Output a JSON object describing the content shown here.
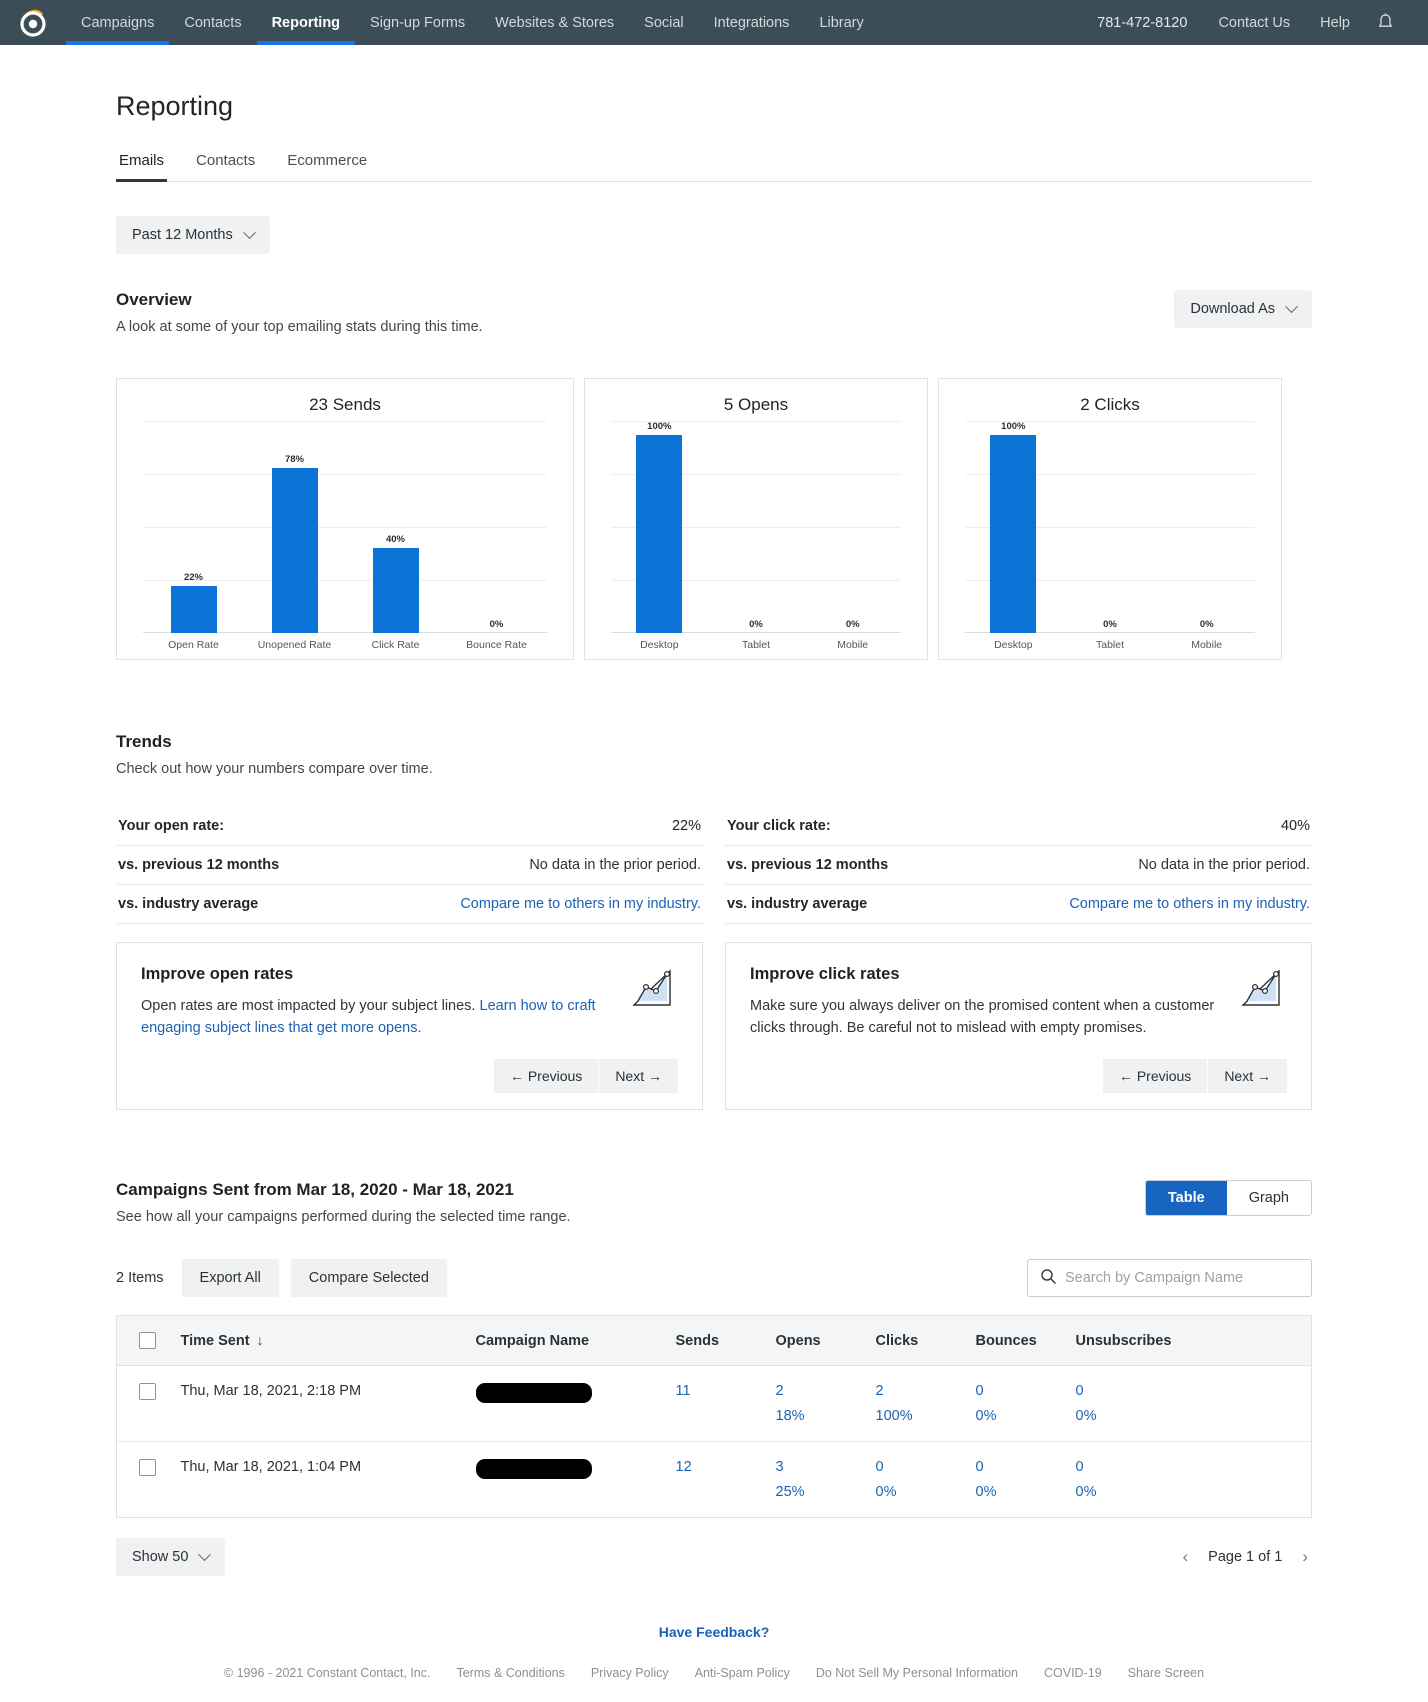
{
  "nav": {
    "logo_icon": "constant-contact-logo-icon",
    "left_items": [
      {
        "label": "Campaigns",
        "active": false
      },
      {
        "label": "Contacts",
        "active": false
      },
      {
        "label": "Reporting",
        "active": true
      },
      {
        "label": "Sign-up Forms",
        "active": false
      },
      {
        "label": "Websites & Stores",
        "active": false
      },
      {
        "label": "Social",
        "active": false
      },
      {
        "label": "Integrations",
        "active": false
      },
      {
        "label": "Library",
        "active": false
      }
    ],
    "phone": "781-472-8120",
    "contact_us": "Contact Us",
    "help": "Help",
    "bell_icon": "notification-bell-icon"
  },
  "page": {
    "title": "Reporting",
    "tabs": [
      {
        "label": "Emails",
        "active": true
      },
      {
        "label": "Contacts",
        "active": false
      },
      {
        "label": "Ecommerce",
        "active": false
      }
    ],
    "date_filter": "Past 12 Months"
  },
  "overview": {
    "title": "Overview",
    "subtitle": "A look at some of your top emailing stats during this time.",
    "download_label": "Download As"
  },
  "trends": {
    "title": "Trends",
    "subtitle": "Check out how your numbers compare over time.",
    "open": {
      "rate_label": "Your open rate:",
      "rate_value": "22%",
      "prev_label": "vs. previous 12 months",
      "prev_value": "No data in the prior period.",
      "industry_label": "vs. industry average",
      "industry_link": "Compare me to others in my industry.",
      "tip_title": "Improve open rates",
      "tip_text_plain": "Open rates are most impacted by your subject lines. ",
      "tip_text_link": "Learn how to craft engaging subject lines that get more opens.",
      "prev_btn": "← Previous",
      "next_btn": "Next →"
    },
    "click": {
      "rate_label": "Your click rate:",
      "rate_value": "40%",
      "prev_label": "vs. previous 12 months",
      "prev_value": "No data in the prior period.",
      "industry_label": "vs. industry average",
      "industry_link": "Compare me to others in my industry.",
      "tip_title": "Improve click rates",
      "tip_text_plain": "Make sure you always deliver on the promised content when a customer clicks through. Be careful not to mislead with empty promises.",
      "tip_text_link": "",
      "prev_btn": "← Previous",
      "next_btn": "Next →"
    }
  },
  "campaigns": {
    "title": "Campaigns Sent from Mar 18, 2020 - Mar 18, 2021",
    "subtitle": "See how all your campaigns performed during the selected time range.",
    "view_toggle": [
      {
        "label": "Table",
        "active": true
      },
      {
        "label": "Graph",
        "active": false
      }
    ],
    "items_count": "2 Items",
    "export_all": "Export All",
    "compare_selected": "Compare Selected",
    "search_placeholder": "Search by Campaign Name",
    "search_value": "",
    "search_icon": "search-icon",
    "columns": [
      "Time Sent",
      "Campaign Name",
      "Sends",
      "Opens",
      "Clicks",
      "Bounces",
      "Unsubscribes"
    ],
    "sort_column": "Time Sent",
    "sort_direction_icon": "arrow-down-icon",
    "rows": [
      {
        "time_sent": "Thu, Mar 18, 2021, 2:18 PM",
        "campaign_name": "",
        "sends": "11",
        "opens": "2",
        "opens_pct": "18%",
        "clicks": "2",
        "clicks_pct": "100%",
        "bounces": "0",
        "bounces_pct": "0%",
        "unsubscribes": "0",
        "unsubscribes_pct": "0%"
      },
      {
        "time_sent": "Thu, Mar 18, 2021, 1:04 PM",
        "campaign_name": "",
        "sends": "12",
        "opens": "3",
        "opens_pct": "25%",
        "clicks": "0",
        "clicks_pct": "0%",
        "bounces": "0",
        "bounces_pct": "0%",
        "unsubscribes": "0",
        "unsubscribes_pct": "0%"
      }
    ],
    "show_per_page": "Show 50",
    "page_label": "Page 1 of 1",
    "prev_page_icon": "chevron-left-icon",
    "next_page_icon": "chevron-right-icon"
  },
  "footer": {
    "feedback": "Have Feedback?",
    "copyright": "© 1996 - 2021 Constant Contact, Inc.",
    "links": [
      "Terms & Conditions",
      "Privacy Policy",
      "Anti-Spam Policy",
      "Do Not Sell My Personal Information",
      "COVID-19",
      "Share Screen"
    ]
  },
  "colors": {
    "nav_bg": "#3b4d56",
    "bar_blue": "#0b72d6",
    "link_blue": "#1b62b5",
    "accent_blue": "#1765c0"
  },
  "chart_data": [
    {
      "type": "bar",
      "title": "23 Sends",
      "categories": [
        "Open Rate",
        "Unopened Rate",
        "Click Rate",
        "Bounce Rate"
      ],
      "values": [
        22,
        78,
        40,
        0
      ],
      "value_labels": [
        "22%",
        "78%",
        "40%",
        "0%"
      ],
      "ylim": [
        0,
        100
      ],
      "xlabel": "",
      "ylabel": "",
      "grid": true,
      "legend": "none",
      "color": "#0b72d6"
    },
    {
      "type": "bar",
      "title": "5 Opens",
      "categories": [
        "Desktop",
        "Tablet",
        "Mobile"
      ],
      "values": [
        100,
        0,
        0
      ],
      "value_labels": [
        "100%",
        "0%",
        "0%"
      ],
      "ylim": [
        0,
        100
      ],
      "xlabel": "",
      "ylabel": "",
      "grid": true,
      "legend": "none",
      "color": "#0b72d6"
    },
    {
      "type": "bar",
      "title": "2 Clicks",
      "categories": [
        "Desktop",
        "Tablet",
        "Mobile"
      ],
      "values": [
        100,
        0,
        0
      ],
      "value_labels": [
        "100%",
        "0%",
        "0%"
      ],
      "ylim": [
        0,
        100
      ],
      "xlabel": "",
      "ylabel": "",
      "grid": true,
      "legend": "none",
      "color": "#0b72d6"
    }
  ]
}
